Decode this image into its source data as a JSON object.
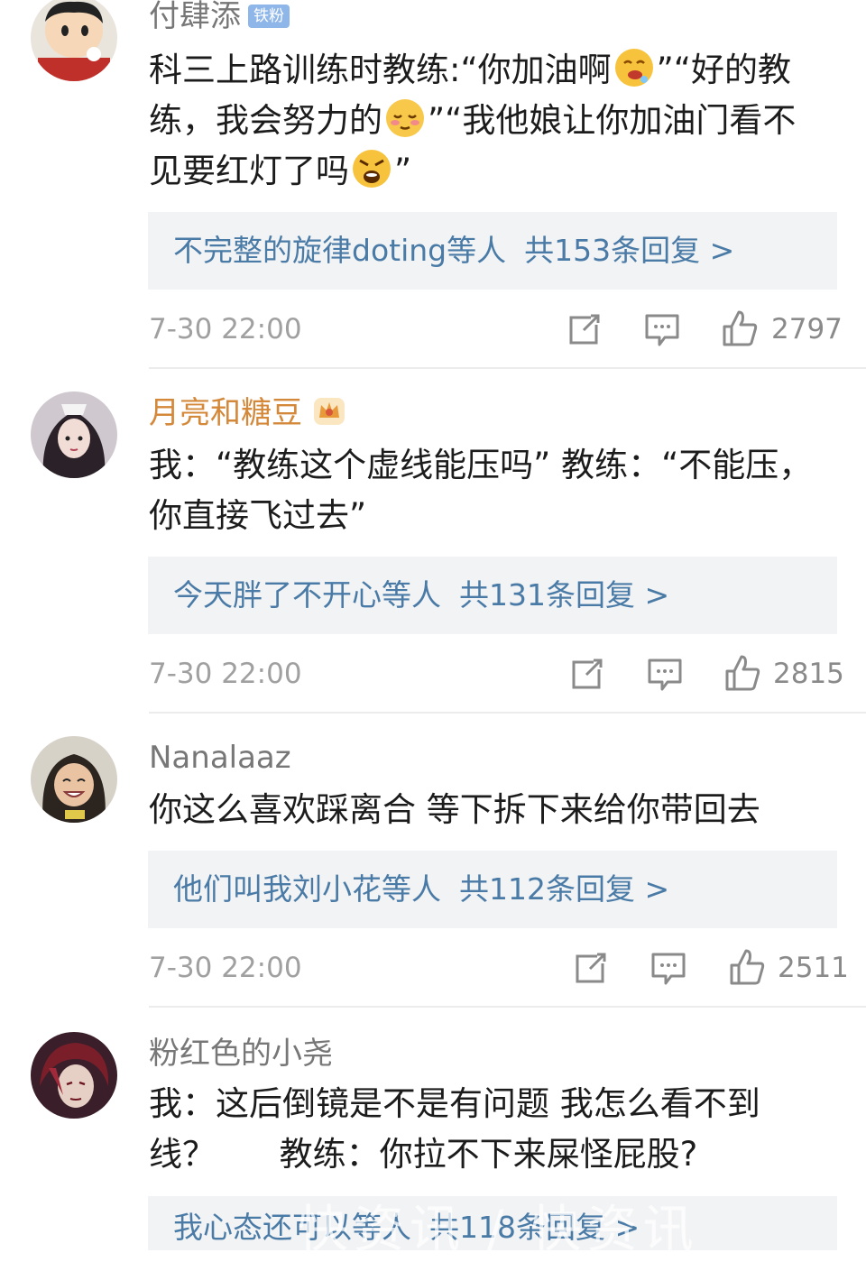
{
  "comments": [
    {
      "username": "付肆添",
      "badge": "铁粉",
      "lines": [
        "科三上路训练时教练:“你加油啊",
        "”“好的教",
        "练，我会努力的",
        "”“我他娘让你加油门看不",
        "见要红灯了吗",
        "”"
      ],
      "replies_users": "不完整的旋律doting等人",
      "replies_count": "共153条回复 >",
      "time": "7-30 22:00",
      "likes": "2797"
    },
    {
      "username": "月亮和糖豆",
      "line1": "我：“教练这个虚线能压吗” 教练：“不能压，",
      "line2": "你直接飞过去”",
      "replies_users": "今天胖了不开心等人",
      "replies_count": "共131条回复 >",
      "time": "7-30 22:00",
      "likes": "2815"
    },
    {
      "username": "Nanalaaz",
      "line1": "你这么喜欢踩离合 等下拆下来给你带回去",
      "replies_users": "他们叫我刘小花等人",
      "replies_count": "共112条回复 >",
      "time": "7-30 22:00",
      "likes": "2511"
    },
    {
      "username": "粉红色的小尧",
      "line1": "我：这后倒镜是不是有问题 我怎么看不到",
      "line2": "线？      教练：你拉不下来屎怪屁股?",
      "replies_users": "我心态还可以等人",
      "replies_count": "共118条回复 >"
    }
  ],
  "watermark": "快资讯 / 快资讯",
  "icons": [
    "share-icon",
    "comment-icon",
    "like-icon"
  ],
  "colors": {
    "link": "#4a7ba6",
    "gold": "#d4883a",
    "reply_bg": "#f2f3f5"
  }
}
